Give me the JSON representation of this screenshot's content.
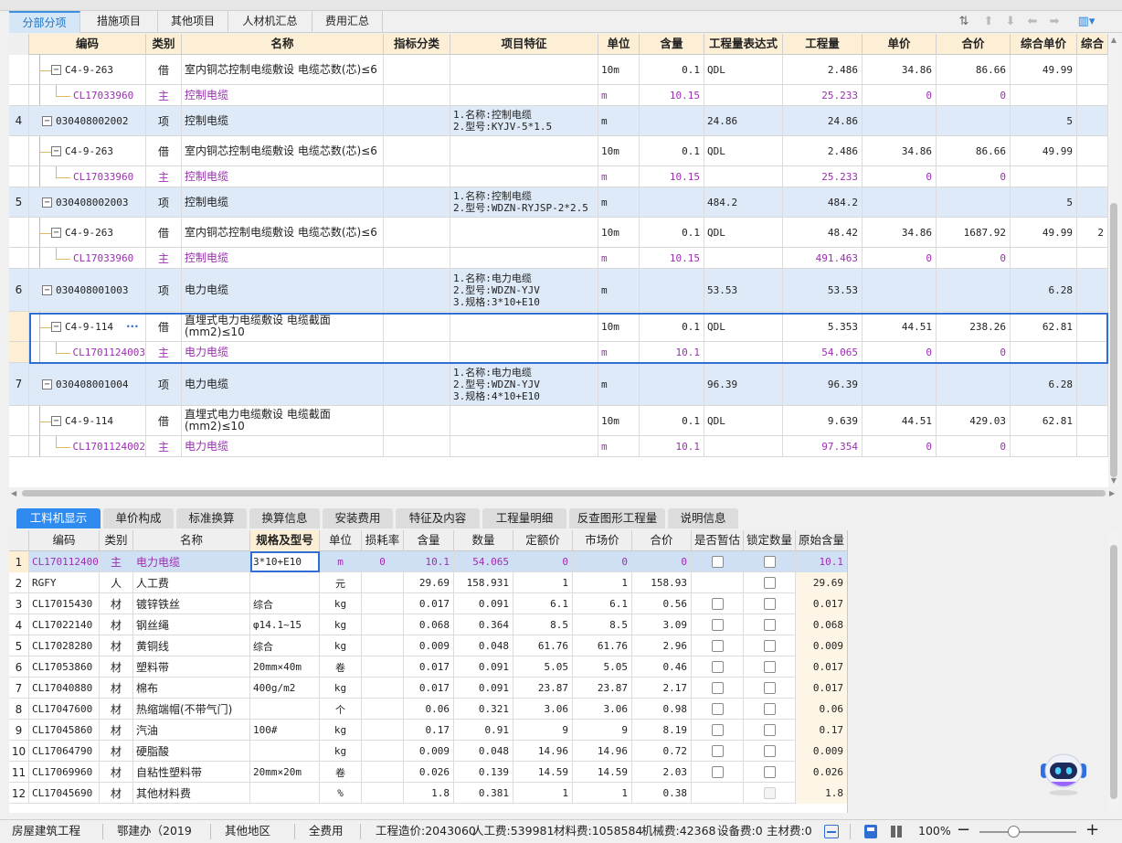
{
  "tabs": [
    {
      "label": "分部分项",
      "active": true
    },
    {
      "label": "措施项目"
    },
    {
      "label": "其他项目"
    },
    {
      "label": "人材机汇总"
    },
    {
      "label": "费用汇总"
    }
  ],
  "main_grid": {
    "headers": [
      "编码",
      "类别",
      "名称",
      "指标分类",
      "项目特征",
      "单位",
      "含量",
      "工程量表达式",
      "工程量",
      "单价",
      "合价",
      "综合单价",
      "综合"
    ],
    "rows": [
      {
        "kind": "de",
        "no": "",
        "code": "C4-9-263",
        "type": "借",
        "name": "室内铜芯控制电缆敷设 电缆芯数(芯)≤6",
        "feature": "",
        "unit": "10m",
        "content": "0.1",
        "expr": "QDL",
        "qty": "2.486",
        "price": "34.86",
        "total": "86.66",
        "comp": "49.99",
        "comp2": ""
      },
      {
        "kind": "mat",
        "no": "",
        "code": "CL17033960",
        "type": "主",
        "name": "控制电缆",
        "feature": "",
        "unit": "m",
        "content": "10.15",
        "expr": "",
        "qty": "25.233",
        "price": "0",
        "total": "0",
        "comp": "",
        "comp2": ""
      },
      {
        "kind": "qd",
        "no": "4",
        "code": "030408002002",
        "type": "项",
        "name": "控制电缆",
        "feature": "1.名称:控制电缆\n2.型号:KYJV-5*1.5",
        "unit": "m",
        "content": "",
        "expr": "24.86",
        "qty": "24.86",
        "price": "",
        "total": "",
        "comp": "5",
        "comp2": ""
      },
      {
        "kind": "de",
        "no": "",
        "code": "C4-9-263",
        "type": "借",
        "name": "室内铜芯控制电缆敷设 电缆芯数(芯)≤6",
        "feature": "",
        "unit": "10m",
        "content": "0.1",
        "expr": "QDL",
        "qty": "2.486",
        "price": "34.86",
        "total": "86.66",
        "comp": "49.99",
        "comp2": ""
      },
      {
        "kind": "mat",
        "no": "",
        "code": "CL17033960",
        "type": "主",
        "name": "控制电缆",
        "feature": "",
        "unit": "m",
        "content": "10.15",
        "expr": "",
        "qty": "25.233",
        "price": "0",
        "total": "0",
        "comp": "",
        "comp2": ""
      },
      {
        "kind": "qd",
        "no": "5",
        "code": "030408002003",
        "type": "项",
        "name": "控制电缆",
        "feature": "1.名称:控制电缆\n2.型号:WDZN-RYJSP-2*2.5",
        "unit": "m",
        "content": "",
        "expr": "484.2",
        "qty": "484.2",
        "price": "",
        "total": "",
        "comp": "5",
        "comp2": ""
      },
      {
        "kind": "de",
        "no": "",
        "code": "C4-9-263",
        "type": "借",
        "name": "室内铜芯控制电缆敷设 电缆芯数(芯)≤6",
        "feature": "",
        "unit": "10m",
        "content": "0.1",
        "expr": "QDL",
        "qty": "48.42",
        "price": "34.86",
        "total": "1687.92",
        "comp": "49.99",
        "comp2": "2"
      },
      {
        "kind": "mat",
        "no": "",
        "code": "CL17033960",
        "type": "主",
        "name": "控制电缆",
        "feature": "",
        "unit": "m",
        "content": "10.15",
        "expr": "",
        "qty": "491.463",
        "price": "0",
        "total": "0",
        "comp": "",
        "comp2": ""
      },
      {
        "kind": "qd",
        "no": "6",
        "code": "030408001003",
        "type": "项",
        "name": "电力电缆",
        "feature": "1.名称:电力电缆\n2.型号:WDZN-YJV\n3.规格:3*10+E10",
        "unit": "m",
        "content": "",
        "expr": "53.53",
        "qty": "53.53",
        "price": "",
        "total": "",
        "comp": "6.28",
        "comp2": ""
      },
      {
        "kind": "de",
        "no": "",
        "code": "C4-9-114",
        "type": "借",
        "name": "直埋式电力电缆敷设 电缆截面(mm2)≤10",
        "feature": "",
        "unit": "10m",
        "content": "0.1",
        "expr": "QDL",
        "qty": "5.353",
        "price": "44.51",
        "total": "238.26",
        "comp": "62.81",
        "comp2": "",
        "selected": true,
        "dots": "···"
      },
      {
        "kind": "mat",
        "no": "",
        "code": "CL1701124003",
        "type": "主",
        "name": "电力电缆",
        "feature": "",
        "unit": "m",
        "content": "10.1",
        "expr": "",
        "qty": "54.065",
        "price": "0",
        "total": "0",
        "comp": "",
        "comp2": "",
        "selected": true
      },
      {
        "kind": "qd",
        "no": "7",
        "code": "030408001004",
        "type": "项",
        "name": "电力电缆",
        "feature": "1.名称:电力电缆\n2.型号:WDZN-YJV\n3.规格:4*10+E10",
        "unit": "m",
        "content": "",
        "expr": "96.39",
        "qty": "96.39",
        "price": "",
        "total": "",
        "comp": "6.28",
        "comp2": ""
      },
      {
        "kind": "de",
        "no": "",
        "code": "C4-9-114",
        "type": "借",
        "name": "直埋式电力电缆敷设 电缆截面(mm2)≤10",
        "feature": "",
        "unit": "10m",
        "content": "0.1",
        "expr": "QDL",
        "qty": "9.639",
        "price": "44.51",
        "total": "429.03",
        "comp": "62.81",
        "comp2": ""
      },
      {
        "kind": "mat",
        "no": "",
        "code": "CL1701124002",
        "type": "主",
        "name": "电力电缆",
        "feature": "",
        "unit": "m",
        "content": "10.1",
        "expr": "",
        "qty": "97.354",
        "price": "0",
        "total": "0",
        "comp": "",
        "comp2": ""
      }
    ]
  },
  "bottom_tabs": [
    {
      "label": "工料机显示",
      "active": true
    },
    {
      "label": "单价构成"
    },
    {
      "label": "标准换算"
    },
    {
      "label": "换算信息"
    },
    {
      "label": "安装费用"
    },
    {
      "label": "特征及内容"
    },
    {
      "label": "工程量明细"
    },
    {
      "label": "反查图形工程量"
    },
    {
      "label": "说明信息"
    }
  ],
  "material_grid": {
    "headers": [
      "",
      "编码",
      "类别",
      "名称",
      "规格及型号",
      "单位",
      "损耗率",
      "含量",
      "数量",
      "定额价",
      "市场价",
      "合价",
      "是否暂估",
      "锁定数量",
      "原始含量"
    ],
    "rows": [
      {
        "no": "1",
        "code": "CL1701124003",
        "type": "主",
        "name": "电力电缆",
        "spec": "3*10+E10",
        "unit": "m",
        "loss": "0",
        "content": "10.1",
        "qty": "54.065",
        "quota": "0",
        "market": "0",
        "total": "0",
        "est": true,
        "lock": true,
        "orig": "10.1",
        "selected": true
      },
      {
        "no": "2",
        "code": "RGFY",
        "type": "人",
        "name": "人工费",
        "spec": "",
        "unit": "元",
        "loss": "",
        "content": "29.69",
        "qty": "158.931",
        "quota": "1",
        "market": "1",
        "total": "158.93",
        "est": false,
        "lock": true,
        "orig": "29.69"
      },
      {
        "no": "3",
        "code": "CL17015430",
        "type": "材",
        "name": "镀锌铁丝",
        "spec": "综合",
        "unit": "kg",
        "loss": "",
        "content": "0.017",
        "qty": "0.091",
        "quota": "6.1",
        "market": "6.1",
        "total": "0.56",
        "est": true,
        "lock": true,
        "orig": "0.017"
      },
      {
        "no": "4",
        "code": "CL17022140",
        "type": "材",
        "name": "钢丝绳",
        "spec": "φ14.1~15",
        "unit": "kg",
        "loss": "",
        "content": "0.068",
        "qty": "0.364",
        "quota": "8.5",
        "market": "8.5",
        "total": "3.09",
        "est": true,
        "lock": true,
        "orig": "0.068"
      },
      {
        "no": "5",
        "code": "CL17028280",
        "type": "材",
        "name": "黄铜线",
        "spec": "综合",
        "unit": "kg",
        "loss": "",
        "content": "0.009",
        "qty": "0.048",
        "quota": "61.76",
        "market": "61.76",
        "total": "2.96",
        "est": true,
        "lock": true,
        "orig": "0.009"
      },
      {
        "no": "6",
        "code": "CL17053860",
        "type": "材",
        "name": "塑料带",
        "spec": "20mm×40m",
        "unit": "卷",
        "loss": "",
        "content": "0.017",
        "qty": "0.091",
        "quota": "5.05",
        "market": "5.05",
        "total": "0.46",
        "est": true,
        "lock": true,
        "orig": "0.017"
      },
      {
        "no": "7",
        "code": "CL17040880",
        "type": "材",
        "name": "棉布",
        "spec": "400g/m2",
        "unit": "kg",
        "loss": "",
        "content": "0.017",
        "qty": "0.091",
        "quota": "23.87",
        "market": "23.87",
        "total": "2.17",
        "est": true,
        "lock": true,
        "orig": "0.017"
      },
      {
        "no": "8",
        "code": "CL17047600",
        "type": "材",
        "name": "热缩端帽(不带气门)",
        "spec": "",
        "unit": "个",
        "loss": "",
        "content": "0.06",
        "qty": "0.321",
        "quota": "3.06",
        "market": "3.06",
        "total": "0.98",
        "est": true,
        "lock": true,
        "orig": "0.06"
      },
      {
        "no": "9",
        "code": "CL17045860",
        "type": "材",
        "name": "汽油",
        "spec": "100#",
        "unit": "kg",
        "loss": "",
        "content": "0.17",
        "qty": "0.91",
        "quota": "9",
        "market": "9",
        "total": "8.19",
        "est": true,
        "lock": true,
        "orig": "0.17"
      },
      {
        "no": "10",
        "code": "CL17064790",
        "type": "材",
        "name": "硬脂酸",
        "spec": "",
        "unit": "kg",
        "loss": "",
        "content": "0.009",
        "qty": "0.048",
        "quota": "14.96",
        "market": "14.96",
        "total": "0.72",
        "est": true,
        "lock": true,
        "orig": "0.009"
      },
      {
        "no": "11",
        "code": "CL17069960",
        "type": "材",
        "name": "自粘性塑料带",
        "spec": "20mm×20m",
        "unit": "卷",
        "loss": "",
        "content": "0.026",
        "qty": "0.139",
        "quota": "14.59",
        "market": "14.59",
        "total": "2.03",
        "est": true,
        "lock": true,
        "orig": "0.026"
      },
      {
        "no": "12",
        "code": "CL17045690",
        "type": "材",
        "name": "其他材料费",
        "spec": "",
        "unit": "%",
        "loss": "",
        "content": "1.8",
        "qty": "0.381",
        "quota": "1",
        "market": "1",
        "total": "0.38",
        "est": false,
        "lock": "disabled",
        "orig": "1.8"
      }
    ]
  },
  "status": {
    "project": "房屋建筑工程",
    "standard": "鄂建办（2019",
    "region": "其他地区",
    "fee": "全费用",
    "cost": "工程造价:2043060",
    "labor": "人工费:539981",
    "material": "材料费:1058584",
    "machine": "机械费:42368",
    "equipment": "设备费:0",
    "main_mat": "主材费:0",
    "zoom": "100%"
  },
  "colors": {
    "accent": "#2f8bef",
    "header": "#fcefd5",
    "qd_row": "#deeaf7",
    "material_text": "#9b2fb0"
  }
}
